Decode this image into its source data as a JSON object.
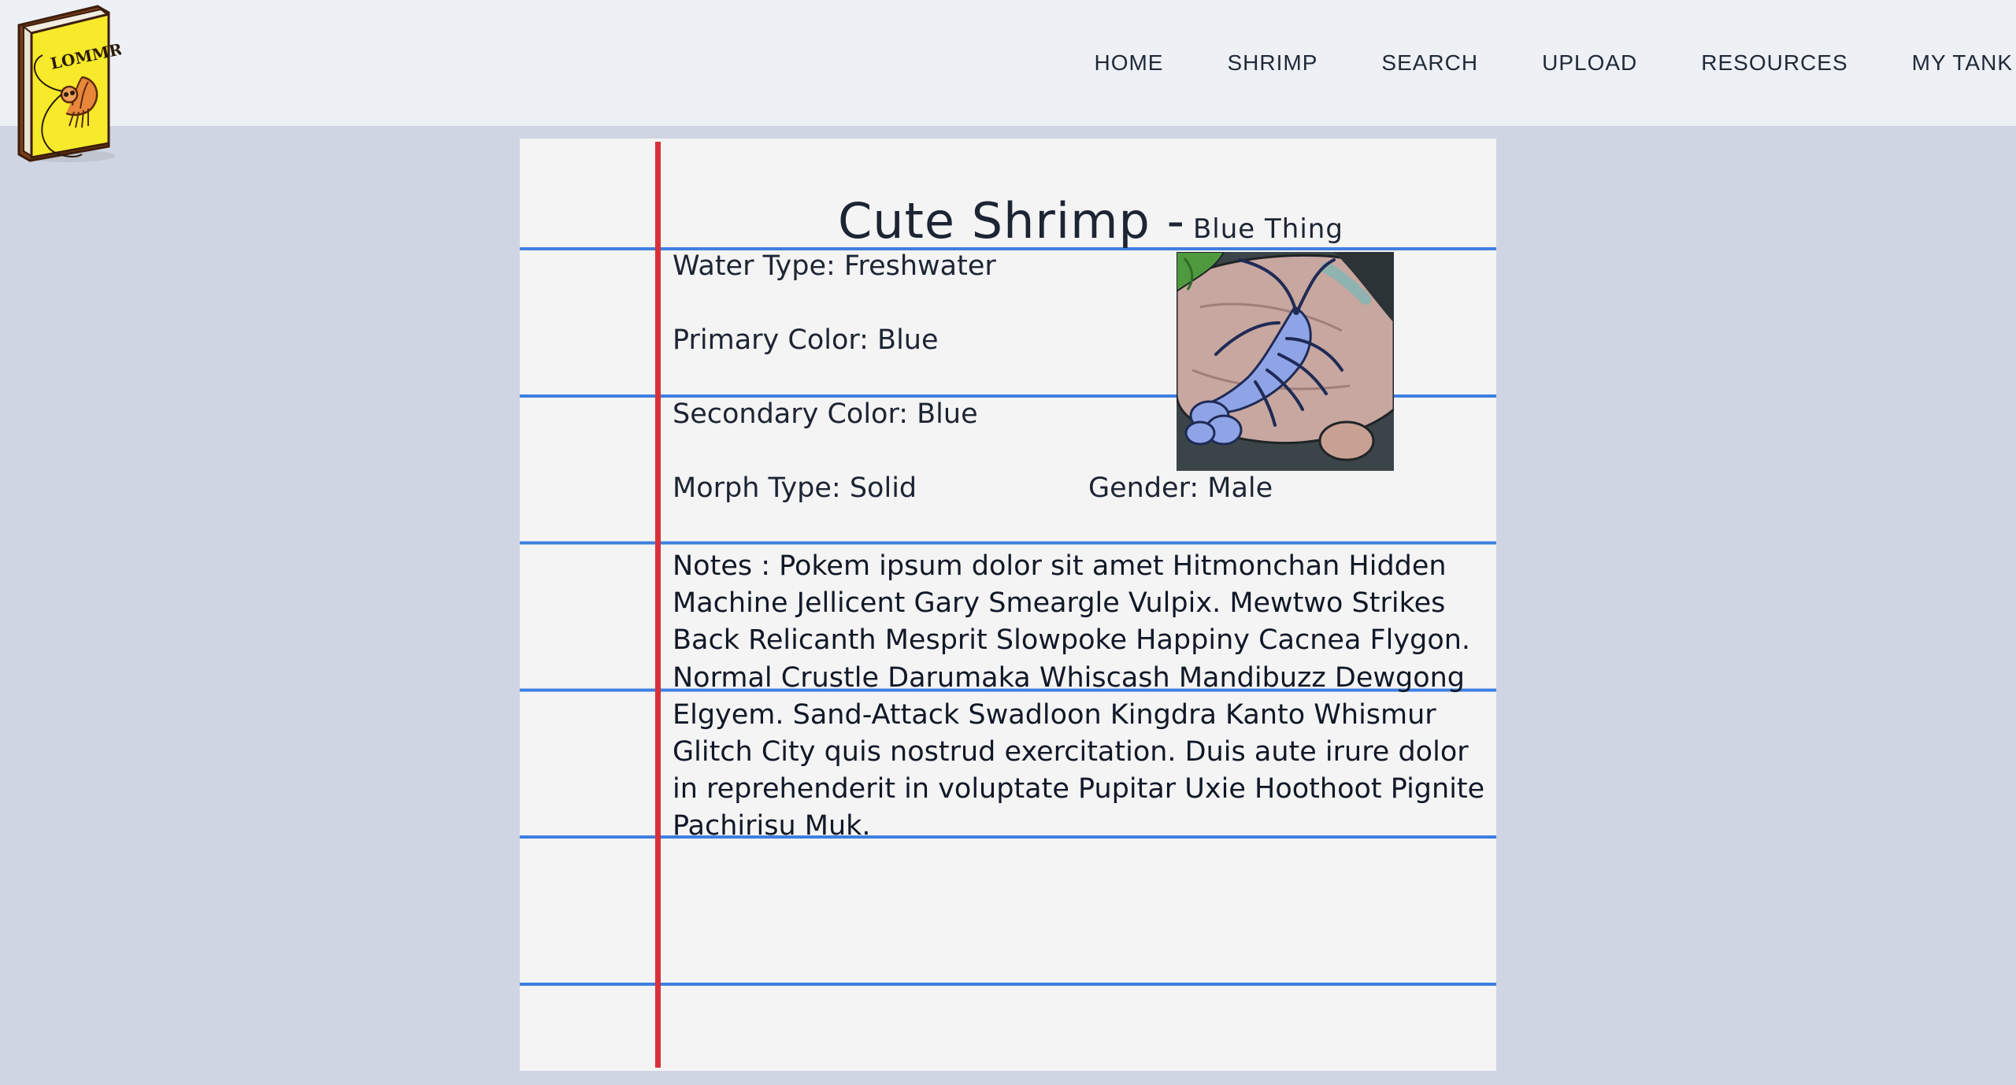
{
  "logo": {
    "text": "LOMMR",
    "icon": "shrimp-book-logo"
  },
  "nav": {
    "items": [
      {
        "label": "HOME"
      },
      {
        "label": "SHRIMP"
      },
      {
        "label": "SEARCH"
      },
      {
        "label": "UPLOAD"
      },
      {
        "label": "RESOURCES"
      },
      {
        "label": "MY TANK"
      }
    ]
  },
  "shrimp": {
    "name": "Cute Shrimp",
    "separator": "-",
    "nickname": "Blue Thing",
    "water_type": "Water Type: Freshwater",
    "primary_color": "Primary Color: Blue",
    "secondary_color": "Secondary Color: Blue",
    "morph_type": "Morph Type: Solid",
    "gender": "Gender: Male",
    "notes": "Notes : Pokem ipsum dolor sit amet Hitmonchan Hidden Machine Jellicent Gary Smeargle Vulpix. Mewtwo Strikes Back Relicanth Mesprit Slowpoke Happiny Cacnea Flygon. Normal Crustle Darumaka Whiscash Mandibuzz Dewgong Elgyem. Sand-Attack Swadloon Kingdra Kanto Whismur Glitch City quis nostrud exercitation. Duis aute irure dolor in reprehenderit in voluptate Pupitar Uxie Hoothoot Pignite Pachirisu Muk."
  },
  "colors": {
    "topbar": "#edf0f5",
    "page_bg": "#cfd5e3",
    "paper": "#f4f4f5",
    "rule_line": "#3f7fe0",
    "margin_line": "#d8303a",
    "shrimp_blue": "#8fa4e6"
  }
}
